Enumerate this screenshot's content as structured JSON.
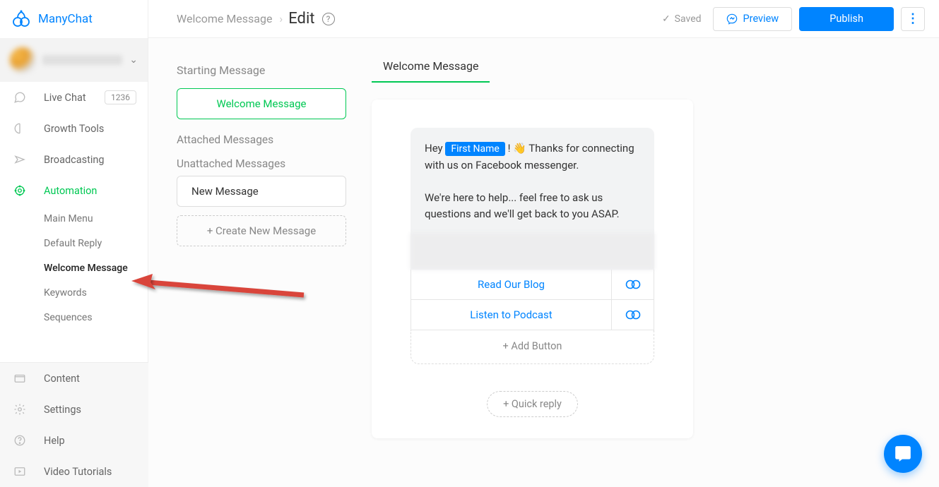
{
  "brand": "ManyChat",
  "sidebar": {
    "items": [
      {
        "label": "Live Chat",
        "badge": "1236"
      },
      {
        "label": "Growth Tools"
      },
      {
        "label": "Broadcasting"
      },
      {
        "label": "Automation",
        "active": true
      }
    ],
    "sub_items": [
      {
        "label": "Main Menu"
      },
      {
        "label": "Default Reply"
      },
      {
        "label": "Welcome Message",
        "active": true
      },
      {
        "label": "Keywords"
      },
      {
        "label": "Sequences"
      }
    ],
    "bottom": [
      {
        "label": "Content"
      },
      {
        "label": "Settings"
      },
      {
        "label": "Help"
      },
      {
        "label": "Video Tutorials"
      }
    ]
  },
  "header": {
    "breadcrumb": "Welcome Message",
    "page": "Edit",
    "saved": "Saved",
    "preview": "Preview",
    "publish": "Publish"
  },
  "panel": {
    "starting_head": "Starting Message",
    "starting_card": "Welcome Message",
    "attached_head": "Attached Messages",
    "unattached_head": "Unattached Messages",
    "new_message": "New Message",
    "create": "+ Create New Message"
  },
  "editor": {
    "tab": "Welcome Message",
    "greeting_prefix": "Hey ",
    "token": "First Name",
    "greeting_suffix_1": " ! 👋 Thanks for connecting with us on Facebook messenger.",
    "body_2": "We're here to help... feel free to ask us questions and we'll get back to you ASAP.",
    "btn1": "Read Our Blog",
    "btn2": "Listen to Podcast",
    "add_button": "+ Add Button",
    "quick_reply": "+ Quick reply"
  }
}
